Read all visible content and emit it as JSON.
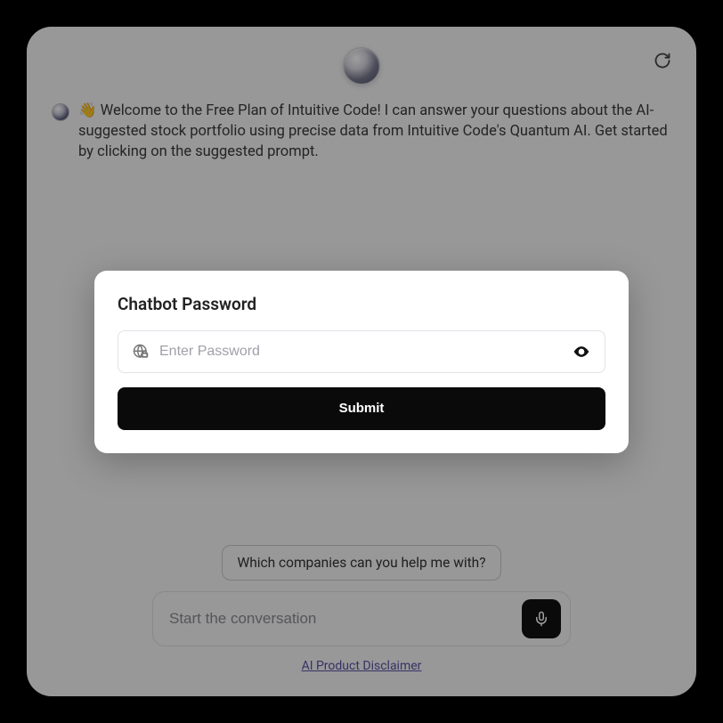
{
  "welcome": {
    "emoji": "👋",
    "text": "Welcome to the Free Plan of Intuitive Code! I can answer your questions about the AI-suggested stock portfolio using precise data from Intuitive Code's Quantum AI. Get started by clicking on the suggested prompt."
  },
  "suggestedPrompt": "Which companies can you help me with?",
  "composer": {
    "placeholder": "Start the conversation"
  },
  "footer": {
    "disclaimer": "AI Product Disclaimer"
  },
  "modal": {
    "title": "Chatbot Password",
    "placeholder": "Enter Password",
    "submit": "Submit"
  }
}
